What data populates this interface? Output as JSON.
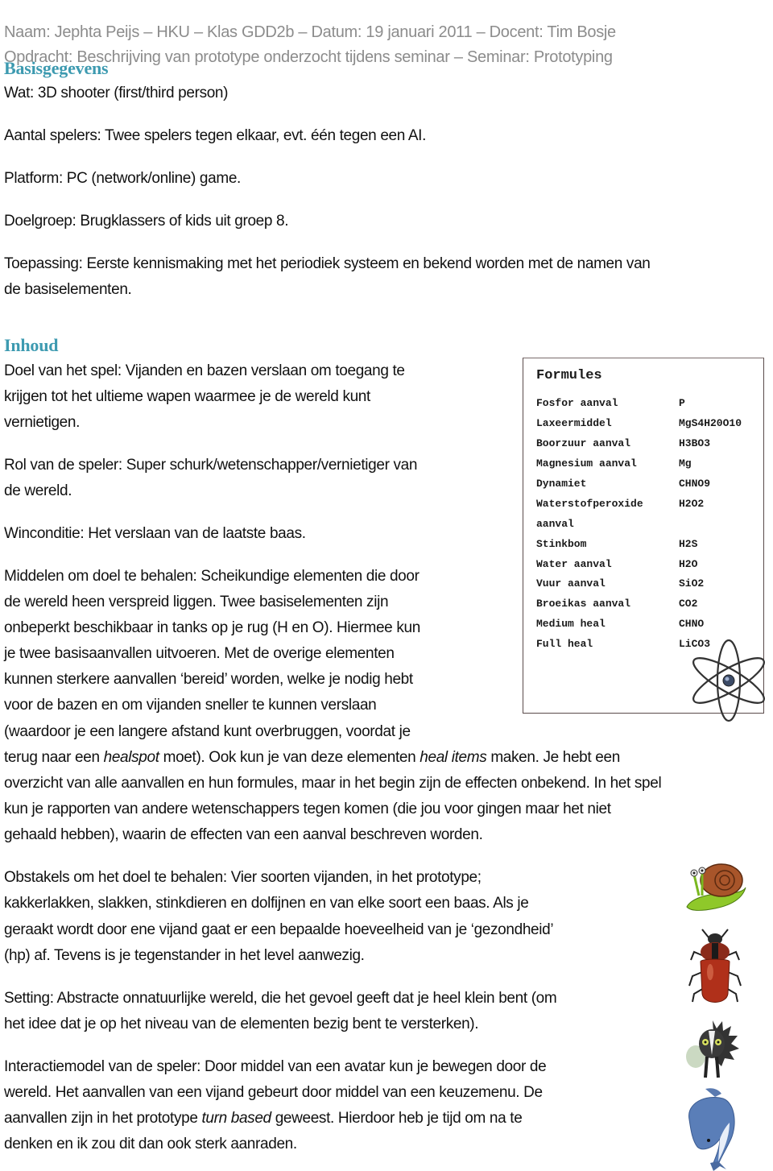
{
  "header": {
    "line1": "Naam: Jephta Peijs – HKU – Klas GDD2b – Datum: 19 januari 2011 – Docent: Tim Bosje",
    "line2": "Opdracht: Beschrijving van prototype onderzocht tijdens seminar – Seminar: Prototyping"
  },
  "basis": {
    "heading": "Basisgegevens",
    "wat": "Wat: 3D shooter (first/third person)",
    "aantal": "Aantal spelers: Twee spelers tegen elkaar, evt. één tegen een AI.",
    "platform": "Platform: PC (network/online) game.",
    "doelgroep": "Doelgroep: Brugklassers of kids uit groep 8.",
    "toepassing": [
      "Toepassing: Eerste kennismaking met het periodiek systeem en bekend worden met de namen van",
      "de basiselementen."
    ]
  },
  "inhoud": {
    "heading": "Inhoud",
    "doel": [
      "Doel van het spel: Vijanden en bazen verslaan om toegang te",
      "krijgen tot het ultieme wapen waarmee je de wereld kunt",
      "vernietigen."
    ],
    "rol": [
      "Rol van de speler: Super schurk/wetenschapper/vernietiger van",
      "de wereld."
    ],
    "winconditie": "Winconditie: Het verslaan van de laatste baas.",
    "middelen": {
      "lines": [
        "Middelen om doel te behalen: Scheikundige elementen die door",
        "de wereld heen verspreid liggen. Twee basiselementen zijn",
        "onbeperkt beschikbaar in tanks op je rug (H en O). Hiermee kun",
        "je twee basisaanvallen uitvoeren. Met de overige elementen",
        "kunnen sterkere aanvallen ‘bereid’ worden, welke je nodig hebt",
        "voor de bazen en om vijanden sneller te kunnen verslaan",
        "(waardoor je een langere afstand kunt overbruggen, voordat je"
      ],
      "line8_a": "terug naar een ",
      "line8_em1": "healspot",
      "line8_b": " moet). Ook kun je van deze elementen ",
      "line8_em2": "heal items",
      "line8_c": " maken. Je hebt een",
      "rest": [
        "overzicht van alle aanvallen en hun formules, maar in het begin zijn de effecten onbekend. In het spel",
        "kun je rapporten van andere wetenschappers tegen komen (die jou voor gingen maar het niet",
        "gehaald hebben), waarin de effecten van een aanval beschreven worden."
      ]
    },
    "obstakels": [
      "Obstakels om het doel te behalen: Vier soorten vijanden, in het prototype;",
      "kakkerlakken, slakken, stinkdieren en dolfijnen en van elke soort een baas. Als je",
      "geraakt wordt door ene vijand gaat er een bepaalde hoeveelheid van je ‘gezondheid’",
      "(hp) af. Tevens is je tegenstander in het level aanwezig."
    ],
    "setting": [
      "Setting: Abstracte onnatuurlijke wereld, die het gevoel geeft dat je heel klein bent (om",
      "het idee dat je op het niveau van de elementen bezig bent te versterken)."
    ],
    "interactie": {
      "line1": "Interactiemodel van de speler: Door middel van een avatar kun je bewegen door de",
      "line2": "wereld. Het aanvallen van een vijand gebeurt door middel van een keuzemenu. De",
      "line3_a": "aanvallen zijn in het prototype ",
      "line3_em": "turn based",
      "line3_b": " geweest. Hierdoor heb je tijd om na te",
      "line4": "denken en ik zou dit dan ook sterk aanraden."
    }
  },
  "formules": {
    "title": "Formules",
    "rows": [
      {
        "name": "Fosfor aanval",
        "value": "P"
      },
      {
        "name": "Laxeermiddel",
        "value": "MgS4H20O10"
      },
      {
        "name": "Boorzuur aanval",
        "value": "H3BO3"
      },
      {
        "name": "Magnesium aanval",
        "value": "Mg"
      },
      {
        "name": "Dynamiet",
        "value": "CHNO9"
      },
      {
        "name": "Waterstofperoxide",
        "value": "H2O2"
      },
      {
        "name": "aanval",
        "value": ""
      },
      {
        "name": "Stinkbom",
        "value": "H2S"
      },
      {
        "name": "Water aanval",
        "value": "H2O"
      },
      {
        "name": "Vuur aanval",
        "value": "SiO2"
      },
      {
        "name": "Broeikas aanval",
        "value": "CO2"
      },
      {
        "name": "Medium heal",
        "value": "CHNO"
      },
      {
        "name": "Full heal",
        "value": "LiCO3"
      }
    ]
  },
  "images": {
    "atom": "atom-icon",
    "creatures": [
      "snail",
      "cockroach",
      "skunk",
      "dolphin"
    ]
  },
  "colors": {
    "heading": "#3d9ab0",
    "header_text": "#8c8c8c",
    "body_text": "#111111"
  }
}
